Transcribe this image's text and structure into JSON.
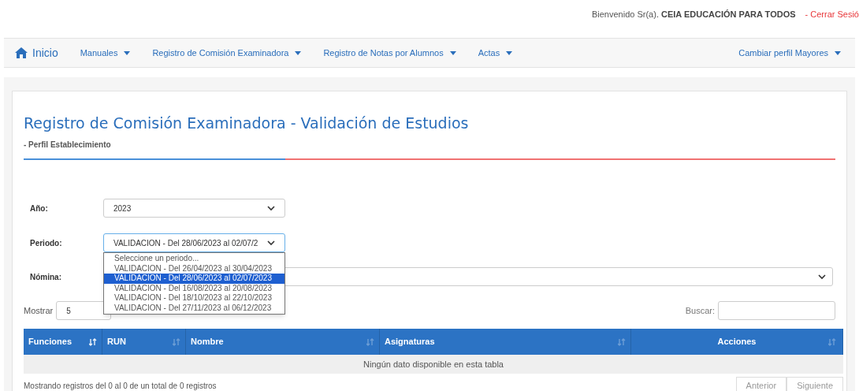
{
  "header": {
    "greeting": "Bienvenido Sr(a).",
    "user": "CEIA EDUCACIÓN PARA TODOS",
    "logout": "- Cerrar Sesió"
  },
  "nav": {
    "items": [
      {
        "label": "Inicio",
        "kind": "home",
        "dropdown": false
      },
      {
        "label": "Manuales",
        "kind": "menu",
        "dropdown": true
      },
      {
        "label": "Registro de Comisión Examinadora",
        "kind": "menu",
        "dropdown": true
      },
      {
        "label": "Registro de Notas por Alumnos",
        "kind": "menu",
        "dropdown": true
      },
      {
        "label": "Actas",
        "kind": "menu",
        "dropdown": true
      }
    ],
    "profile": {
      "label": "Cambiar perfil Mayores",
      "dropdown": true
    }
  },
  "page": {
    "title": "Registro de Comisión Examinadora - Validación de Estudios",
    "subtitle": "- Perfil Establecimiento"
  },
  "form": {
    "year": {
      "label": "Año:",
      "value": "2023"
    },
    "period": {
      "label": "Periodo:",
      "value": "VALIDACION - Del 28/06/2023 al 02/07/2",
      "expanded": true,
      "options": [
        {
          "label": "Seleccione un periodo...",
          "selected": false
        },
        {
          "label": "VALIDACION - Del 26/04/2023 al 30/04/2023",
          "selected": false
        },
        {
          "label": "VALIDACION - Del 28/06/2023 al 02/07/2023",
          "selected": true
        },
        {
          "label": "VALIDACION - Del 16/08/2023 al 20/08/2023",
          "selected": false
        },
        {
          "label": "VALIDACION - Del 18/10/2023 al 22/10/2023",
          "selected": false
        },
        {
          "label": "VALIDACION - Del 27/11/2023 al 06/12/2023",
          "selected": false
        }
      ]
    },
    "roster": {
      "label": "Nómina:"
    }
  },
  "table_controls": {
    "show_label": "Mostrar",
    "page_size": "5",
    "search_label": "Buscar:"
  },
  "table": {
    "columns": [
      {
        "label": "Funciones",
        "sorted": true
      },
      {
        "label": "RUN",
        "sorted": false
      },
      {
        "label": "Nombre",
        "sorted": false
      },
      {
        "label": "Asignaturas",
        "sorted": false
      },
      {
        "label": "Acciones",
        "sorted": false
      }
    ],
    "empty_message": "Ningún dato disponible en esta tabla"
  },
  "footer": {
    "info": "Mostrando registros del 0 al 0 de un total de 0 registros",
    "buttons": [
      "Anterior",
      "Siguiente"
    ]
  }
}
